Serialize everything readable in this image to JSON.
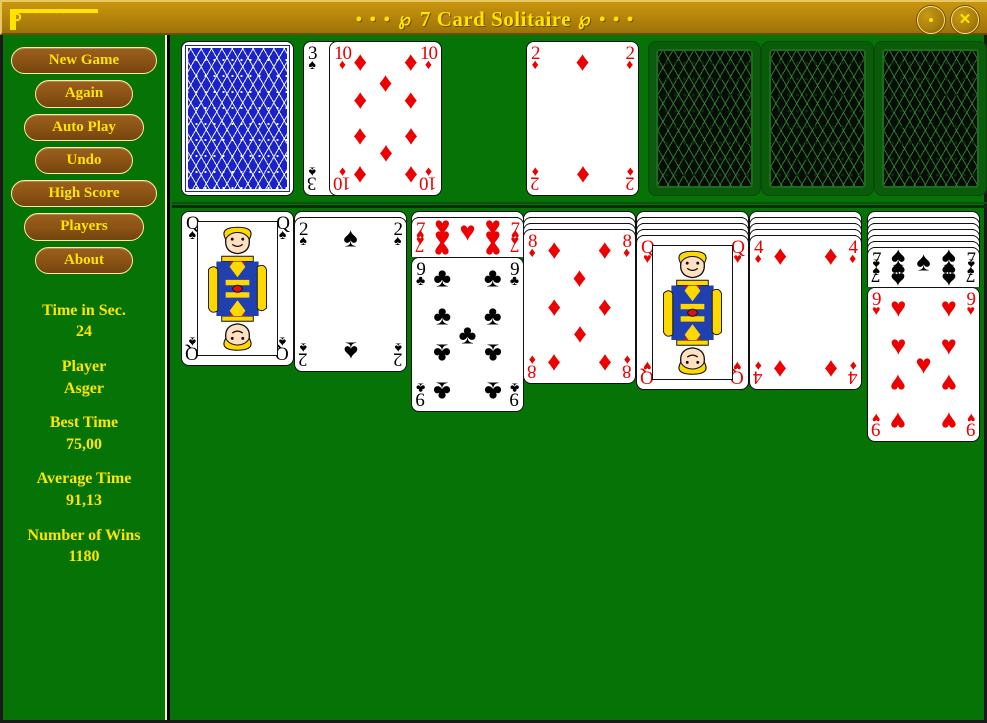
{
  "window": {
    "title": "7 Card Solitaire",
    "ornament_left": "• • • ℘",
    "ornament_right": "℘ • • •",
    "minimize_label": "",
    "close_label": "✕"
  },
  "sidebar": {
    "buttons": [
      {
        "label": "New Game",
        "width": "w-wide"
      },
      {
        "label": "Again",
        "width": "w-narrow"
      },
      {
        "label": "Auto Play",
        "width": "w-mid"
      },
      {
        "label": "Undo",
        "width": "w-narrow"
      },
      {
        "label": "High Score",
        "width": "w-wide"
      },
      {
        "label": "Players",
        "width": "w-mid"
      },
      {
        "label": "About",
        "width": "w-narrow"
      }
    ],
    "stats": [
      {
        "label": "Time in Sec.",
        "value": "24"
      },
      {
        "label": "Player",
        "value": "Asger"
      },
      {
        "label": "Best Time",
        "value": "75,00"
      },
      {
        "label": "Average Time",
        "value": "91,13"
      },
      {
        "label": "Number of Wins",
        "value": "1180"
      }
    ]
  },
  "colors": {
    "felt": "#057305",
    "titlebar": "#b8860b",
    "title_text": "#ffe400",
    "button_face": "#8a5215",
    "button_text": "#ffe400",
    "card_red": "#ec0000",
    "card_black": "#000000",
    "card_back_blue": "#1a23c8"
  },
  "board": {
    "top_row": [
      {
        "kind": "stock",
        "name": "stock-pile"
      },
      {
        "kind": "waste",
        "name": "waste-pile",
        "under": {
          "rank": "3",
          "suit": "spades",
          "color": "black"
        },
        "top": {
          "rank": "10",
          "suit": "diamonds",
          "color": "red"
        }
      },
      {
        "kind": "foundation",
        "name": "foundation-1",
        "top": {
          "rank": "2",
          "suit": "diamonds",
          "color": "red"
        }
      },
      {
        "kind": "foundation-empty",
        "name": "foundation-2"
      },
      {
        "kind": "foundation-empty",
        "name": "foundation-3"
      },
      {
        "kind": "foundation-empty",
        "name": "foundation-4"
      }
    ],
    "tableau": [
      {
        "name": "tableau-column-1",
        "facedown": 0,
        "faceup": [
          {
            "rank": "Q",
            "suit": "spades",
            "color": "black"
          }
        ]
      },
      {
        "name": "tableau-column-2",
        "facedown": 1,
        "faceup": [
          {
            "rank": "2",
            "suit": "spades",
            "color": "black"
          }
        ]
      },
      {
        "name": "tableau-column-3",
        "facedown": 1,
        "faceup": [
          {
            "rank": "7",
            "suit": "hearts",
            "color": "red"
          },
          {
            "rank": "9",
            "suit": "clubs",
            "color": "black"
          }
        ]
      },
      {
        "name": "tableau-column-4",
        "facedown": 3,
        "faceup": [
          {
            "rank": "8",
            "suit": "diamonds",
            "color": "red"
          }
        ]
      },
      {
        "name": "tableau-column-5",
        "facedown": 4,
        "faceup": [
          {
            "rank": "Q",
            "suit": "hearts",
            "color": "red"
          }
        ]
      },
      {
        "name": "tableau-column-6",
        "facedown": 4,
        "faceup": [
          {
            "rank": "4",
            "suit": "diamonds",
            "color": "red"
          }
        ]
      },
      {
        "name": "tableau-column-7",
        "facedown": 6,
        "faceup": [
          {
            "rank": "7",
            "suit": "spades",
            "color": "black"
          },
          {
            "rank": "9",
            "suit": "hearts",
            "color": "red"
          }
        ]
      }
    ]
  }
}
